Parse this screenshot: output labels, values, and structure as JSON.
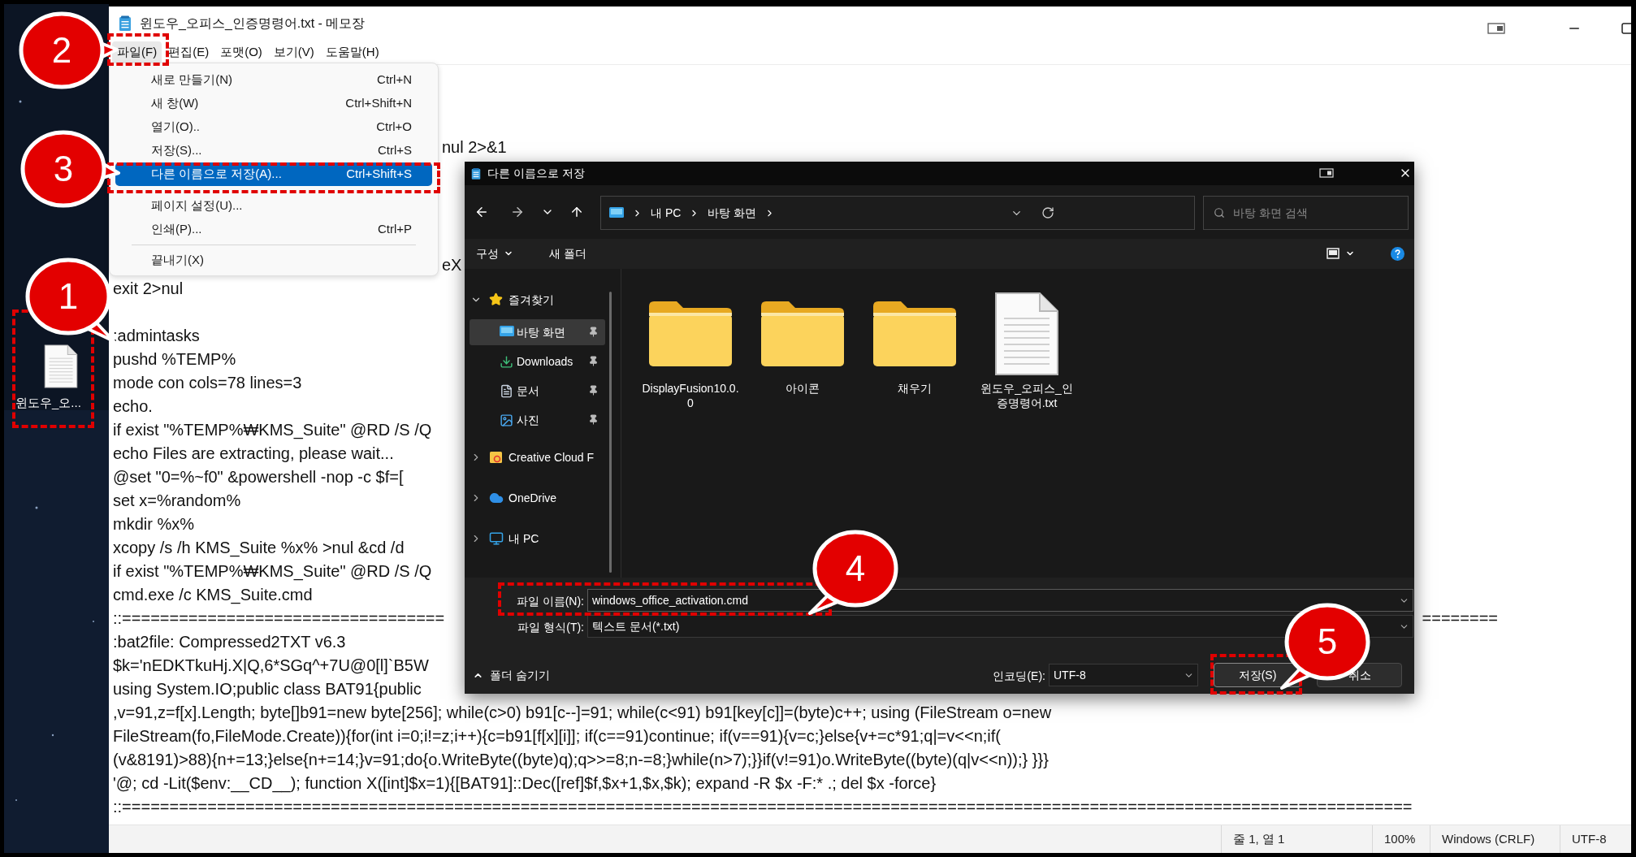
{
  "notepad": {
    "title": "윈도우_오피스_인증명령어.txt - 메모장",
    "menu": [
      {
        "label": "파일(F)",
        "selected": true
      },
      {
        "label": "편집(E)",
        "selected": false
      },
      {
        "label": "포맷(O)",
        "selected": false
      },
      {
        "label": "보기(V)",
        "selected": false
      },
      {
        "label": "도움말(H)",
        "selected": false
      }
    ],
    "fragments": [
      "nul 2>&1",
      "eX"
    ],
    "lines": [
      {
        "kind": "text",
        "text": "exit 2>nul"
      },
      {
        "kind": "blank"
      },
      {
        "kind": "text",
        "text": ":admintasks"
      },
      {
        "kind": "text",
        "text": "pushd %TEMP%"
      },
      {
        "kind": "text",
        "text": "mode con cols=78 lines=3"
      },
      {
        "kind": "text",
        "text": "echo."
      },
      {
        "kind": "text",
        "text": "if exist \"%TEMP%₩KMS_Suite\" @RD /S /Q"
      },
      {
        "kind": "text",
        "text": "echo Files are extracting, please wait..."
      },
      {
        "kind": "text",
        "text": "@set \"0=%~f0\" &powershell -nop -c $f=["
      },
      {
        "kind": "text",
        "text": "set x=%random%"
      },
      {
        "kind": "text",
        "text": "mkdir %x%"
      },
      {
        "kind": "text",
        "text": "xcopy /s /h KMS_Suite %x% >nul &cd /d"
      },
      {
        "kind": "text",
        "text": "if exist \"%TEMP%₩KMS_Suite\" @RD /S /Q"
      },
      {
        "kind": "text",
        "text": "cmd.exe /c KMS_Suite.cmd"
      },
      {
        "kind": "split",
        "text": "::==================================",
        "right": "========"
      },
      {
        "kind": "text",
        "text": ":bat2file: Compressed2TXT v6.3"
      },
      {
        "kind": "text",
        "text": "$k='nEDKTkuHj.X|Q,6*SGq^+7U@0[l]`B5W"
      },
      {
        "kind": "text",
        "text": "using System.IO;public class BAT91{public"
      },
      {
        "kind": "text",
        "text": ",v=91,z=f[x].Length; byte[]b91=new byte[256]; while(c>0) b91[c--]=91; while(c<91) b91[key[c]]=(byte)c++; using (FileStream o=new"
      },
      {
        "kind": "text",
        "text": "FileStream(fo,FileMode.Create)){for(int i=0;i!=z;i++){c=b91[f[x][i]]; if(c==91)continue; if(v==91){v=c;}else{v+=c*91;q|=v<<n;if("
      },
      {
        "kind": "text",
        "text": "(v&8191)>88){n+=13;}else{n+=14;}v=91;do{o.WriteByte((byte)q);q>>=8;n-=8;}while(n>7);}}if(v!=91)o.WriteByte((byte)(q|v<<n));} }}}"
      },
      {
        "kind": "text",
        "text": "'@; cd -Lit($env:__CD__); function X([int]$x=1){[BAT91]::Dec([ref]$f,$x+1,$x,$k); expand -R $x -F:* .; del $x -force}"
      },
      {
        "kind": "text",
        "text": "::========================================================================================================================================"
      }
    ],
    "status_bar": [
      "줄 1, 열 1",
      "100%",
      "Windows (CRLF)",
      "UTF-8"
    ]
  },
  "file_menu": [
    {
      "kind": "item",
      "label": "새로 만들기(N)",
      "shortcut": "Ctrl+N",
      "selected": false
    },
    {
      "kind": "item",
      "label": "새 창(W)",
      "shortcut": "Ctrl+Shift+N",
      "selected": false
    },
    {
      "kind": "item",
      "label": "열기(O)..",
      "shortcut": "Ctrl+O",
      "selected": false
    },
    {
      "kind": "item",
      "label": "저장(S)...",
      "shortcut": "Ctrl+S",
      "selected": false
    },
    {
      "kind": "item",
      "label": "다른 이름으로 저장(A)...",
      "shortcut": "Ctrl+Shift+S",
      "selected": true
    },
    {
      "kind": "gap"
    },
    {
      "kind": "item",
      "label": "페이지 설정(U)...",
      "selected": false
    },
    {
      "kind": "item",
      "label": "인쇄(P)...",
      "shortcut": "Ctrl+P",
      "selected": false
    },
    {
      "kind": "separator"
    },
    {
      "kind": "item",
      "label": "끝내기(X)",
      "selected": false
    }
  ],
  "desktop": {
    "icon_label": "윈도우_오..."
  },
  "dialog": {
    "title": "다른 이름으로 저장",
    "breadcrumb": [
      "내 PC",
      "바탕 화면"
    ],
    "search": {
      "placeholder": "바탕 화면 검색"
    },
    "toolbar": [
      "구성",
      "새 폴더"
    ],
    "nav": [
      {
        "kind": "favorites",
        "label": "즐겨찾기",
        "expanded": true,
        "children": [
          {
            "kind": "desktop",
            "label": "바탕 화면",
            "selected": true,
            "pinned": true
          },
          {
            "kind": "download",
            "label": "Downloads",
            "selected": false,
            "pinned": true
          },
          {
            "kind": "document",
            "label": "문서",
            "selected": false,
            "pinned": true
          },
          {
            "kind": "picture",
            "label": "사진",
            "selected": false,
            "pinned": true
          }
        ]
      },
      {
        "kind": "creative",
        "label": "Creative Cloud F",
        "expanded": false
      },
      {
        "kind": "cloud",
        "label": "OneDrive",
        "expanded": false
      },
      {
        "kind": "pc",
        "label": "내 PC",
        "expanded": false
      }
    ],
    "files": [
      {
        "kind": "folder",
        "label": "DisplayFusion10.0.0"
      },
      {
        "kind": "folder",
        "label": "아이콘"
      },
      {
        "kind": "folder",
        "label": "채우기"
      },
      {
        "kind": "document",
        "label": "윈도우_오피스_인증명령어.txt"
      }
    ],
    "filename": {
      "label": "파일 이름(N):",
      "value": "windows_office_activation.cmd"
    },
    "filetype": {
      "label": "파일 형식(T):",
      "value": "텍스트 문서(*.txt)"
    },
    "hide_folders": "폴더 숨기기",
    "encoding": {
      "label": "인코딩(E):",
      "value": "UTF-8"
    },
    "buttons": [
      "저장(S)",
      "취소"
    ]
  },
  "annotations": [
    {
      "label": "2"
    },
    {
      "label": "3"
    },
    {
      "label": "1"
    },
    {
      "label": "4"
    },
    {
      "label": "5"
    }
  ]
}
